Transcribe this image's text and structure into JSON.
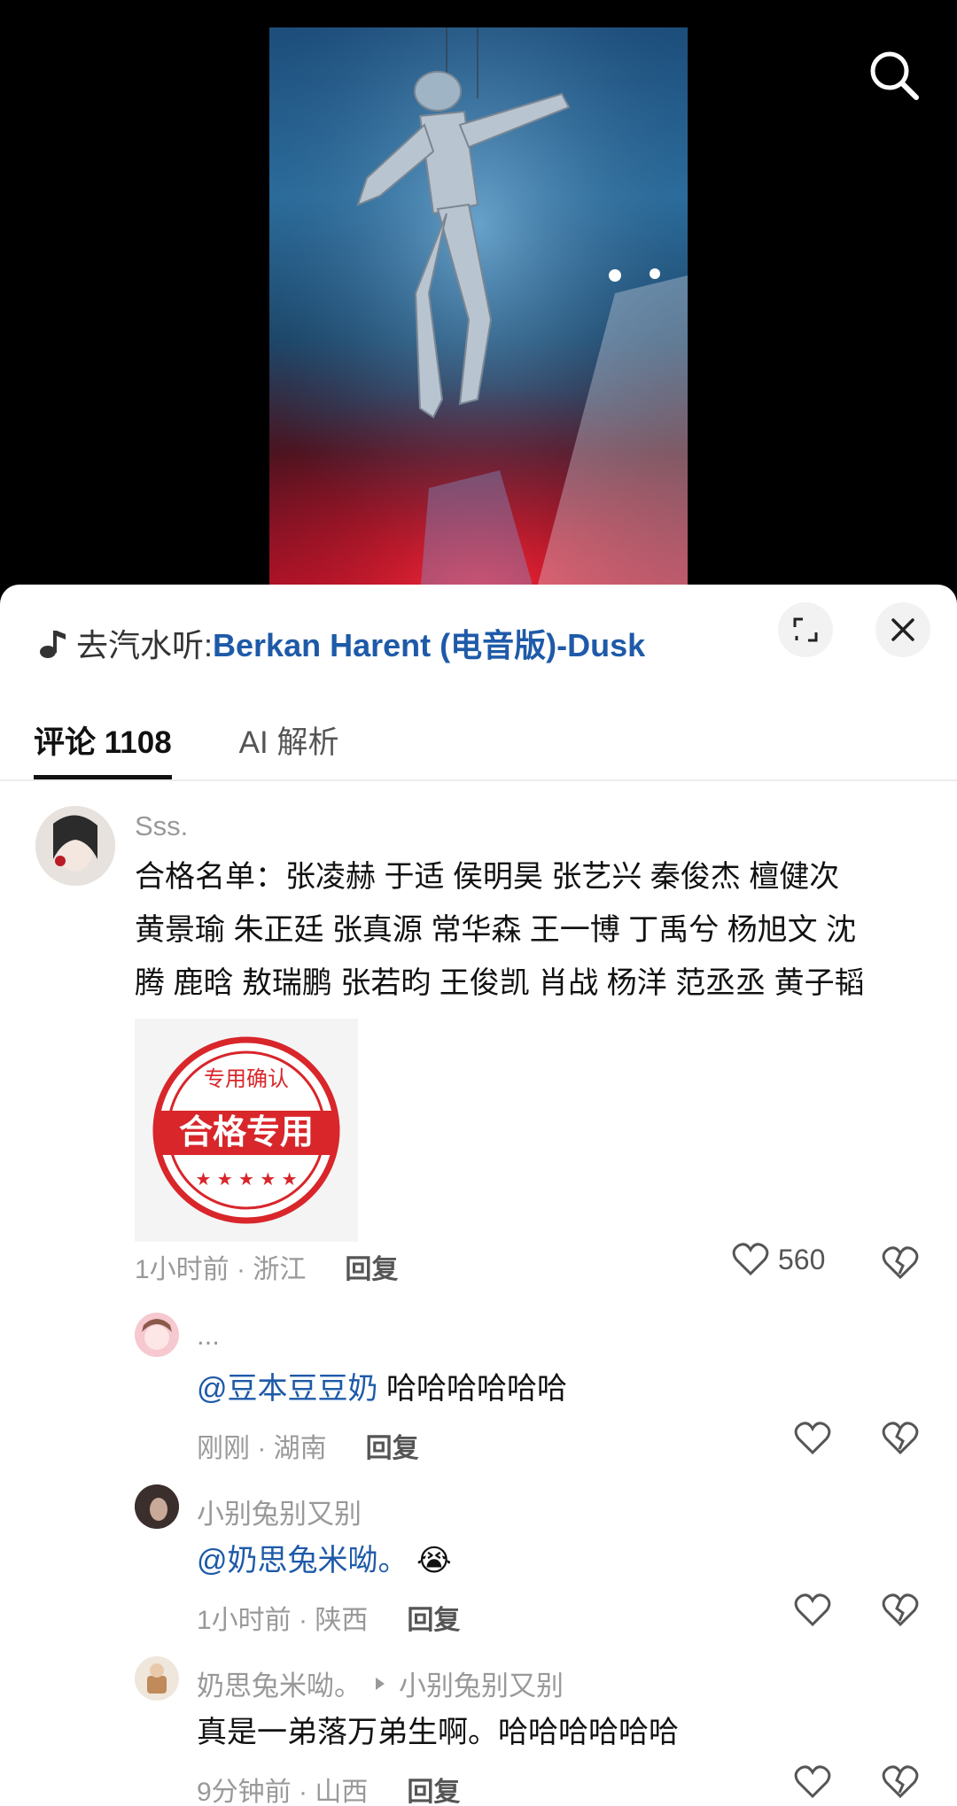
{
  "music": {
    "prefix": "去汽水听:",
    "title": "Berkan Harent (电音版)-Dusk"
  },
  "tabs": [
    {
      "label": "评论 1108",
      "active": true
    },
    {
      "label": "AI 解析",
      "active": false
    }
  ],
  "comments": [
    {
      "username": "Sss.",
      "text_lines": [
        "合格名单：张凌赫 于适 侯明昊 张艺兴  秦俊杰 檀健次",
        "黄景瑜 朱正廷 张真源 常华森 王一博 丁禹兮 杨旭文 沈",
        "腾 鹿晗 敖瑞鹏 张若昀 王俊凯 肖战 杨洋 范丞丞 黄子韬"
      ],
      "image": {
        "stamp_top": "专用确认",
        "stamp_main": "合格专用",
        "stamp_stars": "★ ★ ★ ★ ★"
      },
      "time_location": "1小时前 · 浙江",
      "reply_label": "回复",
      "likes": "560"
    }
  ],
  "replies": [
    {
      "username": "...",
      "mention": "@豆本豆豆奶",
      "text": " 哈哈哈哈哈哈",
      "time_location": "刚刚 · 湖南",
      "reply_label": "回复"
    },
    {
      "username": "小别兔别又别",
      "mention": "@奶思兔米呦。",
      "text": "",
      "emoji": "😭",
      "time_location": "1小时前 · 陕西",
      "reply_label": "回复"
    },
    {
      "username": "奶思兔米呦。",
      "reply_to": "小别兔别又别",
      "text": "真是一弟落万弟生啊。哈哈哈哈哈哈",
      "time_location": "9分钟前 · 山西",
      "reply_label": "回复"
    }
  ],
  "colors": {
    "link_blue": "#1e5aa8",
    "stamp_red": "#d8262b"
  }
}
